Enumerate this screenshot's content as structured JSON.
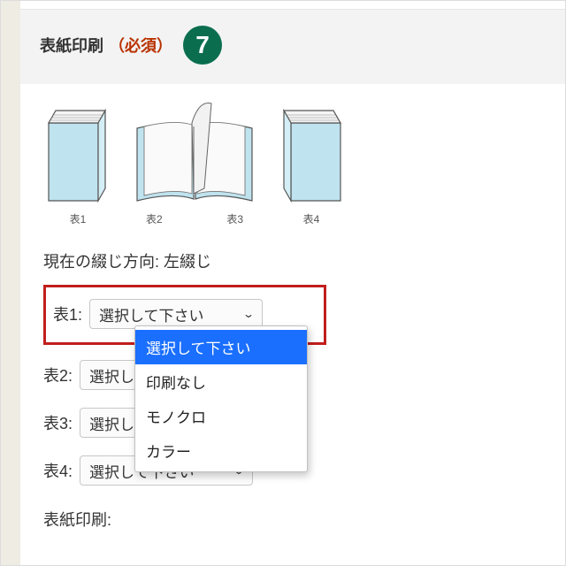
{
  "header": {
    "title": "表紙印刷",
    "required": "（必須）",
    "step": "7"
  },
  "colors": {
    "accent": "#0a6e4e",
    "highlight": "#c11f1d",
    "required_text": "#b93200",
    "dropdown_selected": "#1a6fff"
  },
  "diagram": {
    "captions": [
      "表1",
      "表2",
      "表3",
      "表4"
    ]
  },
  "binding": {
    "label": "現在の綴じ方向:",
    "value": "左綴じ"
  },
  "rows": [
    {
      "label": "表1:",
      "value": "選択して下さい",
      "highlighted": true,
      "open": true
    },
    {
      "label": "表2:",
      "value": "選択して下さい",
      "highlighted": false,
      "open": false
    },
    {
      "label": "表3:",
      "value": "選択して下さい",
      "highlighted": false,
      "open": false
    },
    {
      "label": "表4:",
      "value": "選択して下さい",
      "highlighted": false,
      "open": false
    }
  ],
  "dropdown_options": [
    "選択して下さい",
    "印刷なし",
    "モノクロ",
    "カラー"
  ],
  "summary_label": "表紙印刷:"
}
